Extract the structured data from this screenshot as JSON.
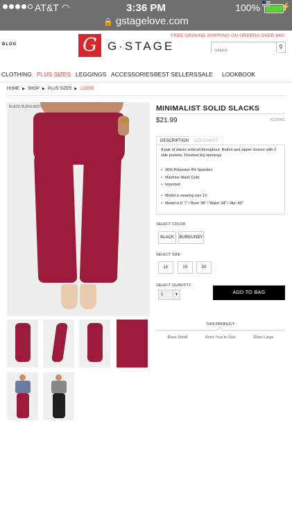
{
  "status": {
    "carrier": "AT&T",
    "time": "3:36 PM",
    "battery": "100%",
    "url": "gstagelove.com"
  },
  "header": {
    "blog_badge": "BLOG",
    "logo_mark": "G",
    "logo_text": "G·STAGE",
    "shipping": "FREE GROUND SHIPPING ON ORDERS OVER $40!",
    "search_placeholder": "Search"
  },
  "nav": [
    "CLOTHING",
    "PLUS SIZES",
    "LEGGINGS",
    "ACCESSORIES",
    "BEST SELLERS",
    "SALE",
    "LOOKBOOK"
  ],
  "breadcrumb": [
    "HOME",
    "SHOP",
    "PLUS SIZES",
    "122055"
  ],
  "product": {
    "image_badge": "BLACK BURGUNDY",
    "title": "MINIMALIST SOLID SLACKS",
    "price": "$21.99",
    "sku": "#122055",
    "tabs": [
      "DESCRIPTION",
      "SIZE CHART"
    ],
    "description": "A pair of slacks solid all throughout. Button and zipper closure with 2 side pockets. Finished leg openings.",
    "features": [
      "96% Polyester 4% Spandex",
      "Machine Wash Cold",
      "Imported"
    ],
    "model": [
      "Model is wearing size 1X",
      "Model is 5' 7\" / Bust: 38\" / Waist: 34\" / Hip: 40\""
    ],
    "color_label": "SELECT COLOR",
    "colors": [
      "BLACK",
      "BURGUNDY"
    ],
    "size_label": "SELECT SIZE",
    "sizes": [
      "1X",
      "2X",
      "3X"
    ],
    "qty_label": "SELECT QUANTITY",
    "qty_value": "1",
    "add_to_bag": "ADD TO BAG",
    "fit_title": "THIS PRODUCT:",
    "fit_options": [
      "Runs Small",
      "Runs True to Size",
      "Runs Large"
    ]
  },
  "colors": {
    "accent": "#e3413c",
    "product": "#9b1b3a",
    "logo": "#d6262e"
  }
}
